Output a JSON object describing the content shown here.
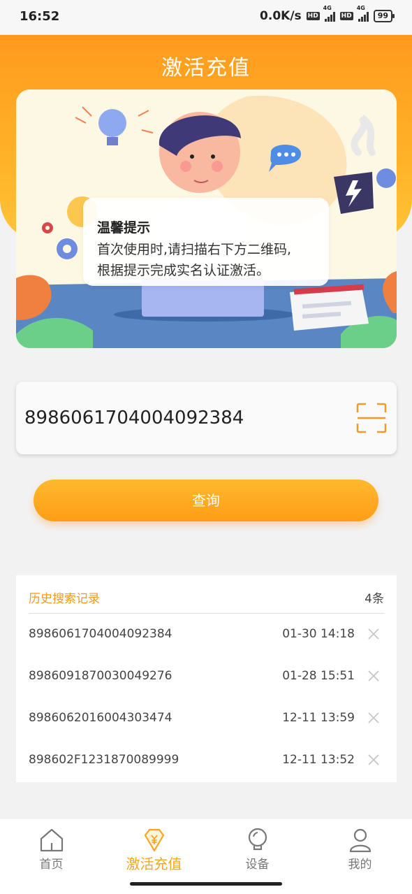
{
  "status_bar": {
    "time": "16:52",
    "net_speed": "0.0K/s",
    "hd1": "HD",
    "sig1": "4G",
    "hd2": "HD",
    "sig2": "4G",
    "battery": "99"
  },
  "header": {
    "title": "激活充值"
  },
  "banner": {
    "tip_title": "温馨提示",
    "tip_line1": "首次使用时,请扫描右下方二维码,",
    "tip_line2": "根据提示完成实名认证激活。"
  },
  "search": {
    "value": "8986061704004092384",
    "button_label": "查询"
  },
  "history": {
    "title": "历史搜索记录",
    "count": "4条",
    "rows": [
      {
        "number": "8986061704004092384",
        "time": "01-30 14:18"
      },
      {
        "number": "8986091870030049276",
        "time": "01-28 15:51"
      },
      {
        "number": "8986062016004303474",
        "time": "12-11 13:59"
      },
      {
        "number": "898602F1231870089999",
        "time": "12-11 13:52"
      }
    ]
  },
  "nav": [
    {
      "label": "首页"
    },
    {
      "label": "激活充值"
    },
    {
      "label": "设备"
    },
    {
      "label": "我的"
    }
  ],
  "colors": {
    "accent": "#f5a623",
    "header_orange": "#ff9a1e",
    "history_title": "#f39a1a"
  }
}
